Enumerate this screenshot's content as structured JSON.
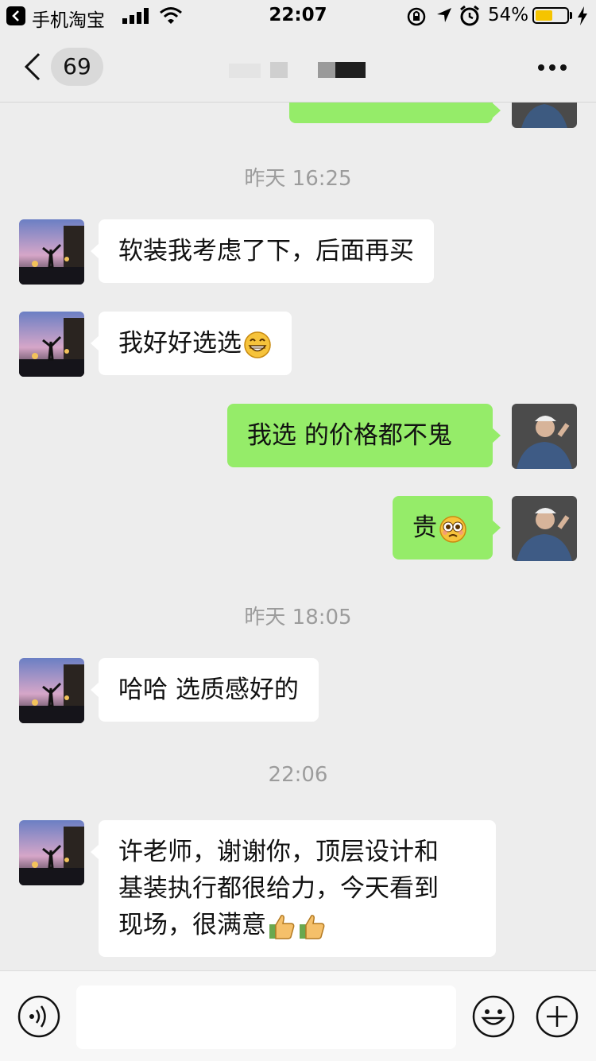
{
  "status_bar": {
    "back_app": "手机淘宝",
    "time": "22:07",
    "battery_percent": "54%",
    "battery_level": 0.54,
    "icons": [
      "back-to-app-icon",
      "signal-icon",
      "wifi-icon",
      "orientation-lock-icon",
      "location-icon",
      "alarm-icon",
      "battery-icon",
      "charging-icon"
    ]
  },
  "nav": {
    "unread_count": "69",
    "more_icon": "more-icon"
  },
  "messages": [
    {
      "type": "timestamp",
      "text": "昨天 16:25"
    },
    {
      "type": "incoming",
      "text": "软装我考虑了下，后面再买"
    },
    {
      "type": "incoming",
      "text": "我好好选选",
      "emoji": "grin-emoji"
    },
    {
      "type": "outgoing",
      "text": "我选 的价格都不鬼"
    },
    {
      "type": "outgoing",
      "text": "贵",
      "emoji": "pleading-emoji"
    },
    {
      "type": "timestamp",
      "text": "昨天 18:05"
    },
    {
      "type": "incoming",
      "text": "哈哈 选质感好的"
    },
    {
      "type": "timestamp",
      "text": "22:06"
    },
    {
      "type": "incoming",
      "lines": [
        "许老师，谢谢你，顶层设计和",
        "基装执行都很给力，今天看到",
        "现场，很满意"
      ],
      "emoji": "thumbs-up-emoji x2"
    }
  ],
  "input_bar": {
    "placeholder": "",
    "icons": [
      "voice-icon",
      "emoji-icon",
      "plus-icon"
    ]
  },
  "colors": {
    "background": "#ededed",
    "outgoing_bubble": "#95ec69",
    "incoming_bubble": "#ffffff",
    "timestamp": "#9c9c9c"
  }
}
